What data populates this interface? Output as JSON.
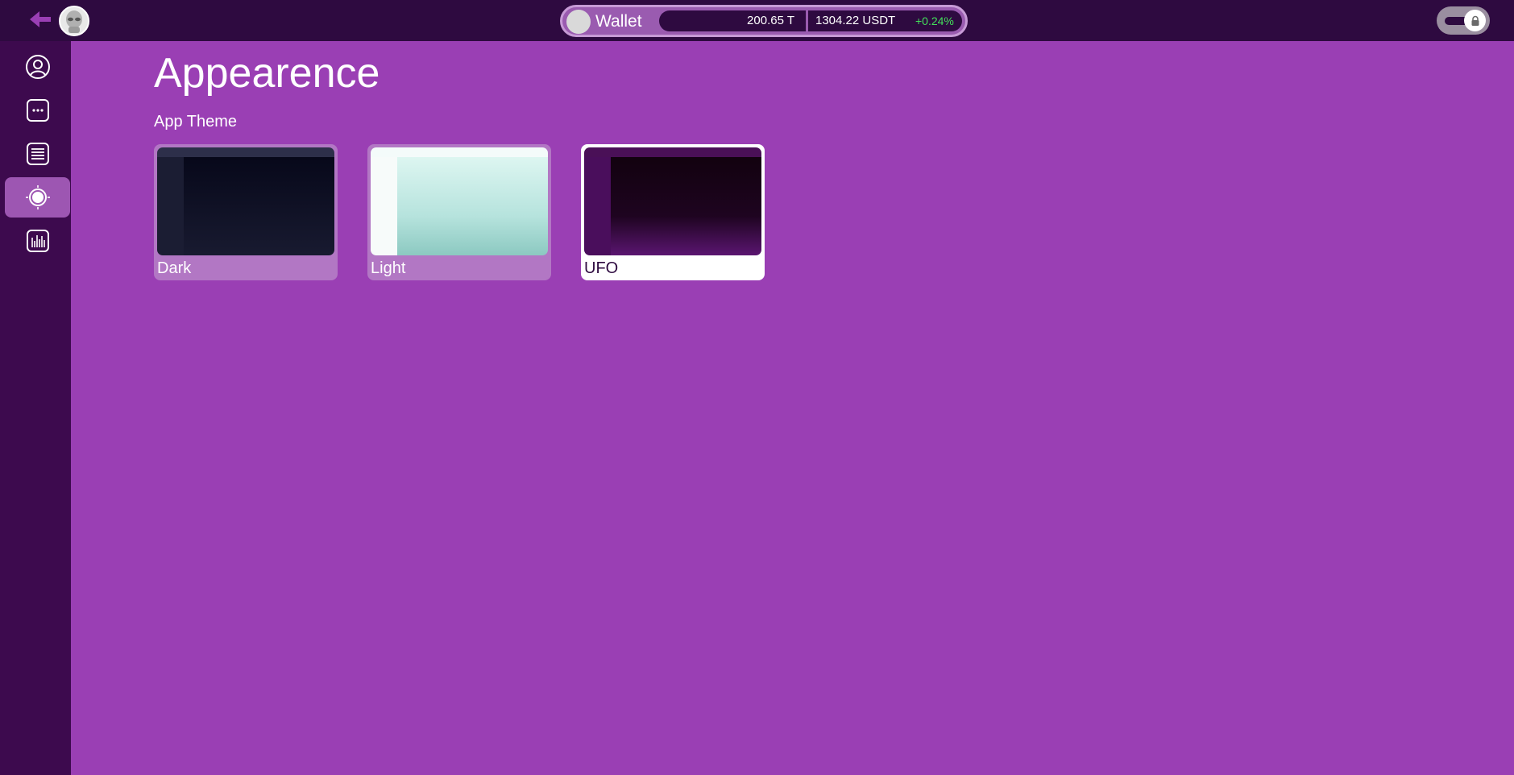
{
  "topbar": {
    "wallet": {
      "label": "Wallet",
      "balance": "200.65 T",
      "usdt_value": "1304.22 USDT",
      "change": "+0.24%"
    }
  },
  "sidebar": {
    "items": [
      {
        "icon": "user-circle-icon"
      },
      {
        "icon": "chat-dots-icon"
      },
      {
        "icon": "document-lines-icon"
      },
      {
        "icon": "appearance-sun-icon",
        "active": true
      },
      {
        "icon": "waveform-icon"
      }
    ]
  },
  "main": {
    "title": "Appearence",
    "section_label": "App Theme",
    "themes": [
      {
        "name": "Dark",
        "selected": false
      },
      {
        "name": "Light",
        "selected": false
      },
      {
        "name": "UFO",
        "selected": true
      }
    ]
  },
  "colors": {
    "background": "#9a3fb4",
    "topbar": "#2e0a40",
    "sidebar": "#3d0a4e",
    "positive": "#43e05a"
  }
}
